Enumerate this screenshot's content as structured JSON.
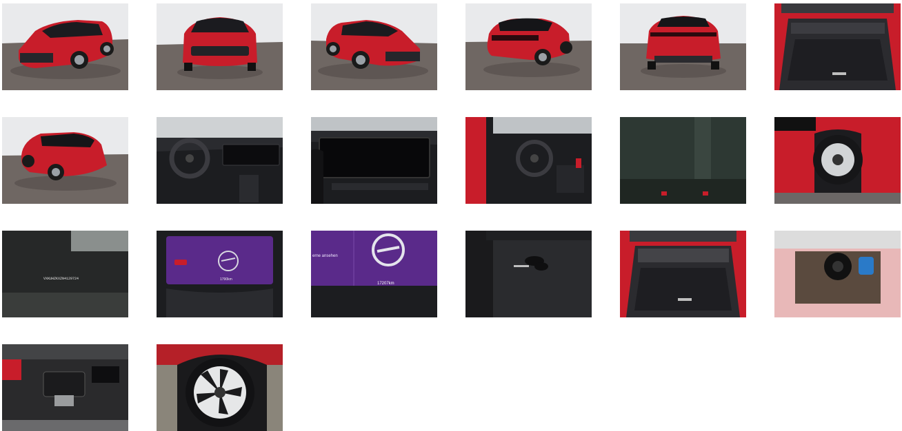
{
  "gallery": {
    "photos": [
      {
        "subject": "car-front-left"
      },
      {
        "subject": "car-front"
      },
      {
        "subject": "car-front-right"
      },
      {
        "subject": "car-rear-right"
      },
      {
        "subject": "car-rear"
      },
      {
        "subject": "trunk-open"
      },
      {
        "subject": "car-rear-left"
      },
      {
        "subject": "dashboard"
      },
      {
        "subject": "infotainment-screen"
      },
      {
        "subject": "driver-area"
      },
      {
        "subject": "rear-seat"
      },
      {
        "subject": "front-wheel-side"
      },
      {
        "subject": "vin-plate",
        "text": "VXKUHZKXZN4129724"
      },
      {
        "subject": "instrument-cluster",
        "text": "1790km"
      },
      {
        "subject": "cluster-closeup",
        "text_left": "erne ansehen",
        "text_km": "17207km"
      },
      {
        "subject": "car-keys"
      },
      {
        "subject": "trunk-floor"
      },
      {
        "subject": "spare-wheel-well"
      },
      {
        "subject": "engine-bay"
      },
      {
        "subject": "wheel-rim"
      }
    ]
  },
  "colors": {
    "car_red": "#c81d2a",
    "studio_wall": "#e9eaec",
    "studio_floor": "#6f6763",
    "interior_dark": "#1c1d20",
    "screen_purple": "#5a2a8a"
  }
}
